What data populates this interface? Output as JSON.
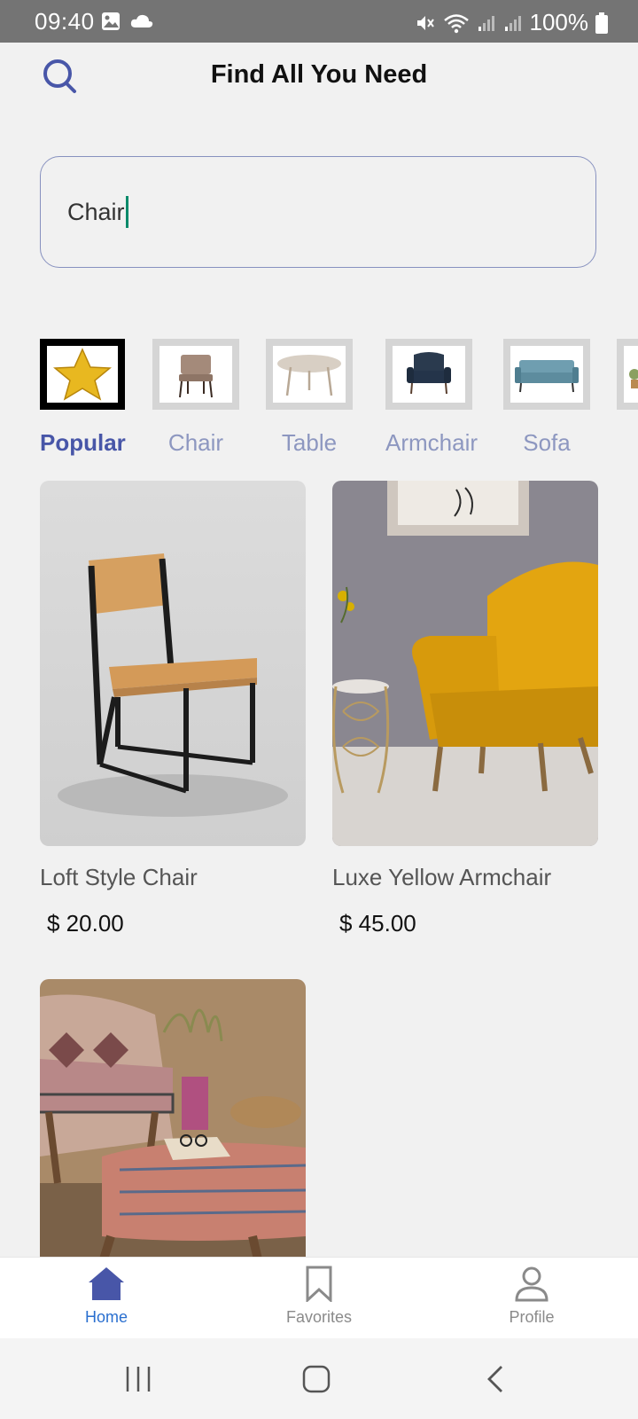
{
  "status_bar": {
    "time": "09:40",
    "battery": "100%",
    "icons": [
      "image-icon",
      "cloud-icon",
      "mute-icon",
      "wifi-icon",
      "signal-icon",
      "signal-icon",
      "battery-icon"
    ]
  },
  "header": {
    "title": "Find All You Need",
    "search_icon": "search-icon"
  },
  "search": {
    "value": "Chair"
  },
  "categories": [
    {
      "label": "Popular",
      "selected": true,
      "icon": "star-icon"
    },
    {
      "label": "Chair",
      "selected": false,
      "icon": "chair-thumbnail"
    },
    {
      "label": "Table",
      "selected": false,
      "icon": "table-thumbnail"
    },
    {
      "label": "Armchair",
      "selected": false,
      "icon": "armchair-thumbnail"
    },
    {
      "label": "Sofa",
      "selected": false,
      "icon": "sofa-thumbnail"
    }
  ],
  "products": [
    {
      "name": "Loft Style Chair",
      "price": "$ 20.00"
    },
    {
      "name": "Luxe Yellow Armchair",
      "price": "$ 45.00"
    },
    {
      "name": "",
      "price": ""
    }
  ],
  "bottom_nav": [
    {
      "label": "Home",
      "icon": "home-icon",
      "active": true
    },
    {
      "label": "Favorites",
      "icon": "bookmark-icon",
      "active": false
    },
    {
      "label": "Profile",
      "icon": "profile-icon",
      "active": false
    }
  ],
  "colors": {
    "accent": "#4856a8",
    "inactive_label": "#8d97c0",
    "active_nav": "#2a6fcf",
    "status_bar": "#747474",
    "background": "#f1f1f1"
  }
}
